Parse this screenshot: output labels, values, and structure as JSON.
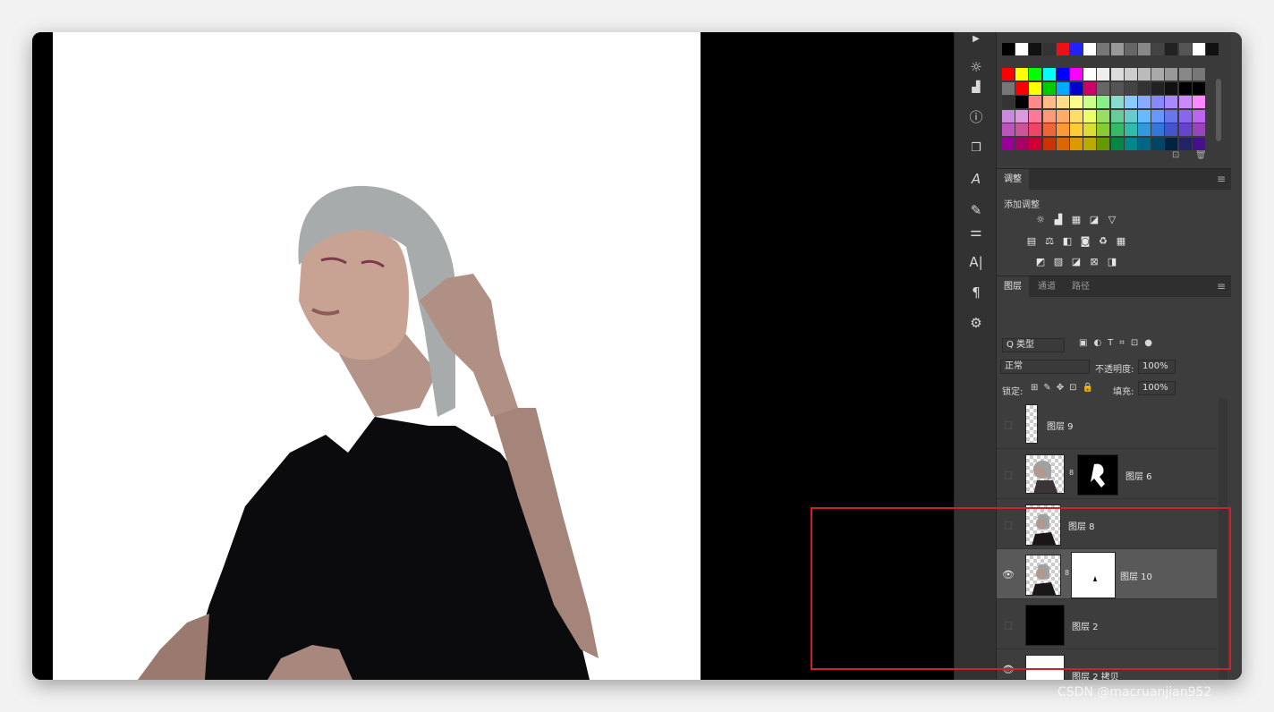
{
  "adjustments": {
    "tab": "调整",
    "subtitle": "添加调整"
  },
  "layers": {
    "tabs": [
      "图层",
      "通道",
      "路径"
    ],
    "filter_label": "Q 类型",
    "blend_mode": "正常",
    "opacity_label": "不透明度:",
    "opacity_value": "100%",
    "lock_label": "锁定:",
    "fill_label": "填充:",
    "fill_value": "100%",
    "items": [
      {
        "name": "图层 9",
        "visible": false
      },
      {
        "name": "图层 6",
        "visible": false
      },
      {
        "name": "图层 8",
        "visible": false
      },
      {
        "name": "图层 10",
        "visible": true,
        "selected": true
      },
      {
        "name": "图层 2",
        "visible": false
      },
      {
        "name": "图层 2 拷贝",
        "visible": true
      }
    ]
  },
  "colors": {
    "highlight": "#d0202a",
    "panel_bg": "#3d3d3d",
    "selected_row": "#595959"
  },
  "icons": [
    "play-icon",
    "brightness-icon",
    "levels-icon",
    "info-icon",
    "swatch-icon",
    "character-icon",
    "brush-settings-icon",
    "sliders-icon",
    "text-icon",
    "paragraph-icon",
    "adjustments-icon"
  ],
  "watermark": "CSDN @macruanjian952"
}
